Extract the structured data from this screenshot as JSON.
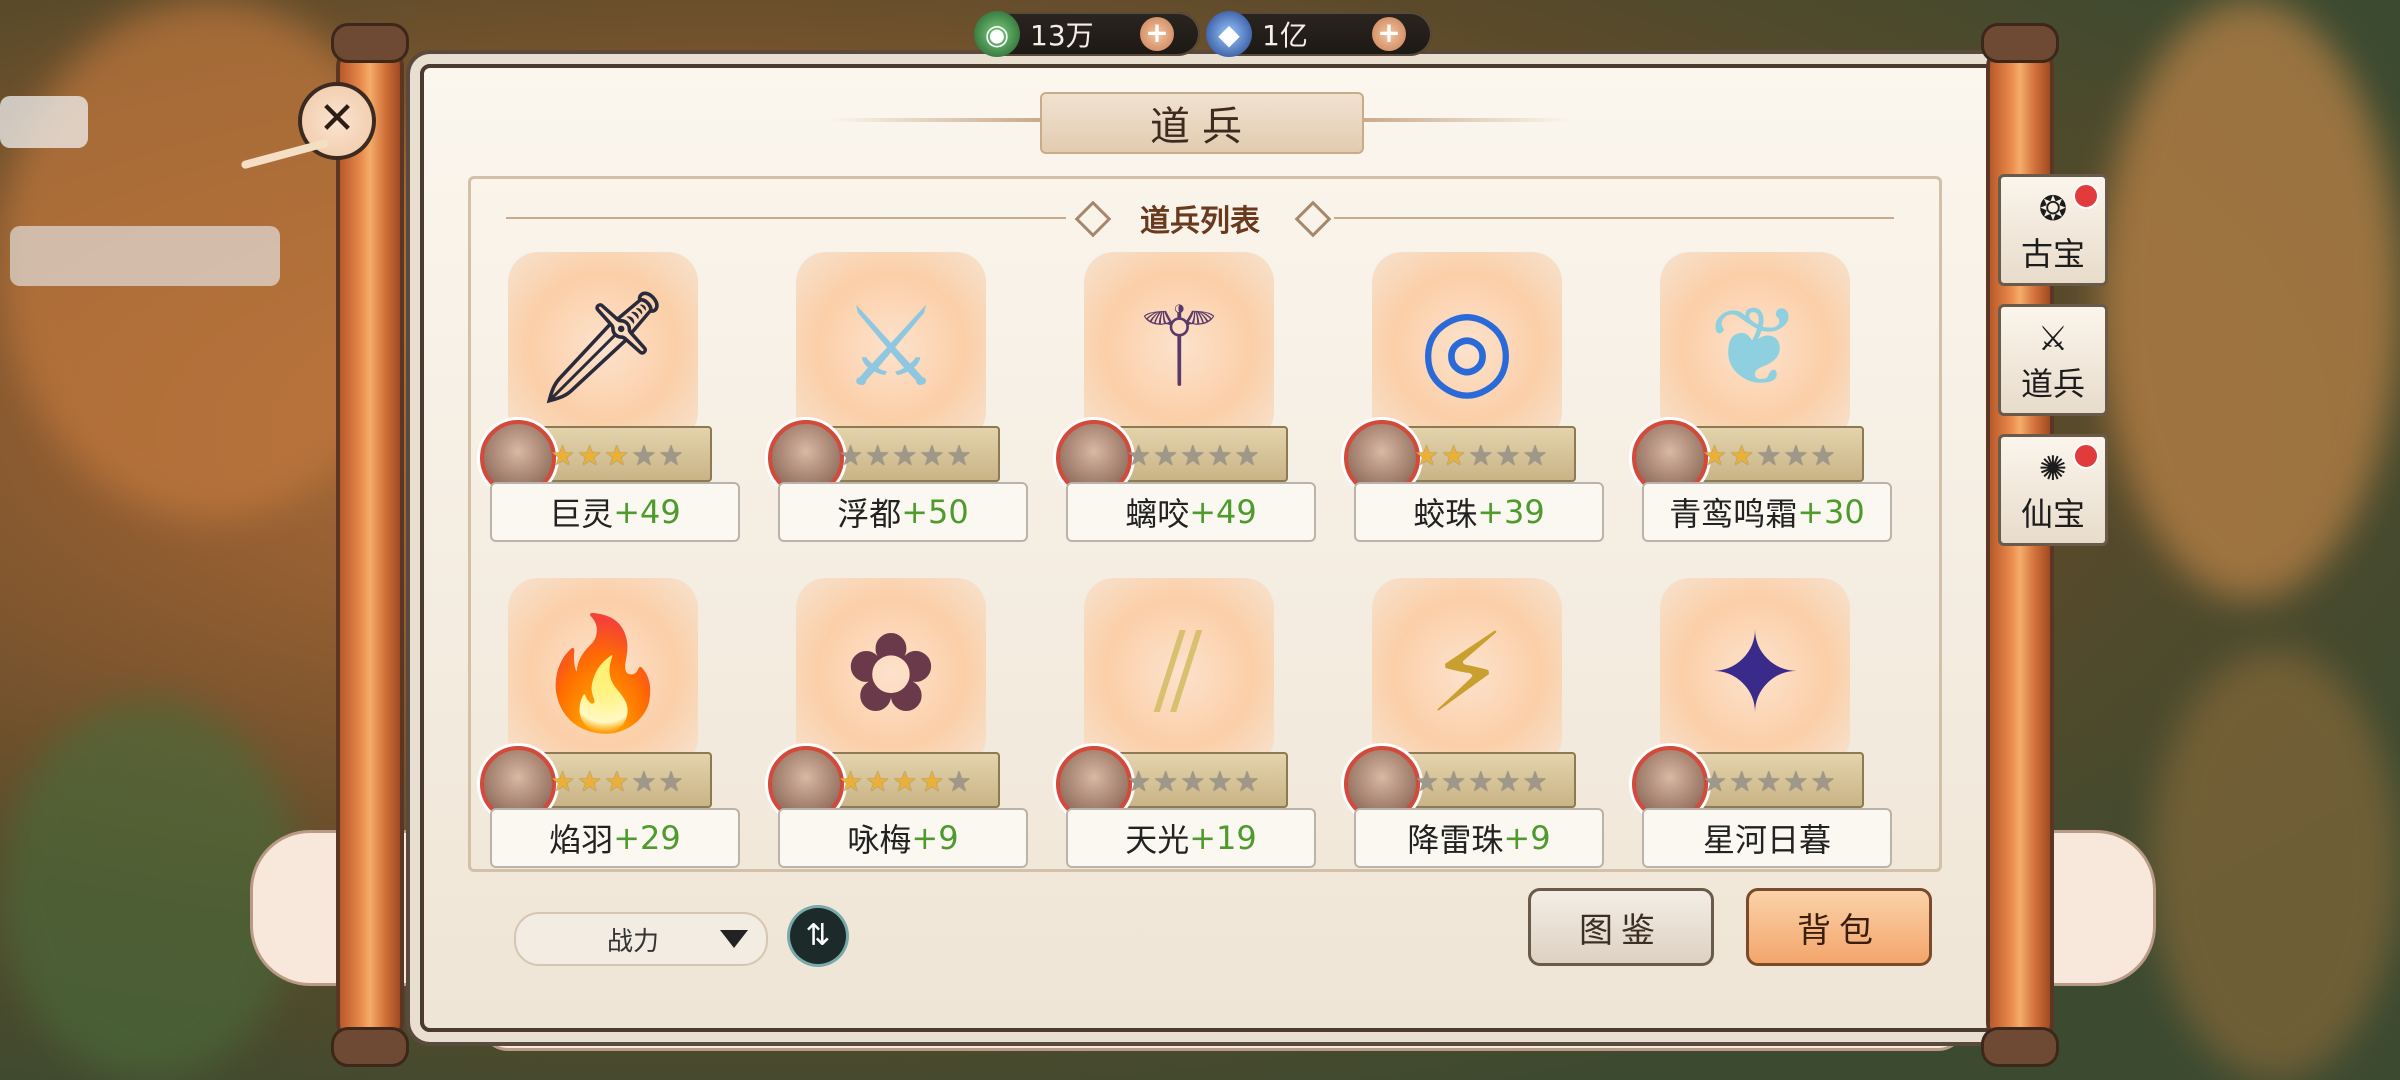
{
  "currency": [
    {
      "icon": "jade-coin-icon",
      "value": "13万"
    },
    {
      "icon": "blue-crystal-icon",
      "value": "1亿"
    }
  ],
  "window": {
    "title": "道兵"
  },
  "list": {
    "header": "道兵列表"
  },
  "items": [
    {
      "name": "巨灵",
      "level": "+49",
      "stars": 3,
      "weapon_icon": "dark-dagger-icon"
    },
    {
      "name": "浮都",
      "level": "+50",
      "stars": 0,
      "weapon_icon": "crystal-sword-icon"
    },
    {
      "name": "螭咬",
      "level": "+49",
      "stars": 0,
      "weapon_icon": "serpent-staff-icon"
    },
    {
      "name": "蛟珠",
      "level": "+39",
      "stars": 2,
      "weapon_icon": "dragon-orb-icon"
    },
    {
      "name": "青鸾鸣霜",
      "level": "+30",
      "stars": 2,
      "weapon_icon": "feather-fan-icon"
    },
    {
      "name": "焰羽",
      "level": "+29",
      "stars": 3,
      "weapon_icon": "flame-sword-icon"
    },
    {
      "name": "咏梅",
      "level": "+9",
      "stars": 4,
      "weapon_icon": "plum-brush-icon"
    },
    {
      "name": "天光",
      "level": "+19",
      "stars": 0,
      "weapon_icon": "triple-blade-icon"
    },
    {
      "name": "降雷珠",
      "level": "+9",
      "stars": 0,
      "weapon_icon": "thunder-orb-icon"
    },
    {
      "name": "星河日暮",
      "level": "",
      "stars": 0,
      "weapon_icon": "galaxy-blade-icon"
    }
  ],
  "sort": {
    "selected": "战力"
  },
  "buttons": {
    "guide": "图鉴",
    "bag": "背包"
  },
  "side_tabs": [
    {
      "label": "古宝",
      "icon": "ancient-treasure-icon",
      "badge": true
    },
    {
      "label": "道兵",
      "icon": "sword-icon",
      "badge": false
    },
    {
      "label": "仙宝",
      "icon": "immortal-treasure-icon",
      "badge": true
    }
  ]
}
